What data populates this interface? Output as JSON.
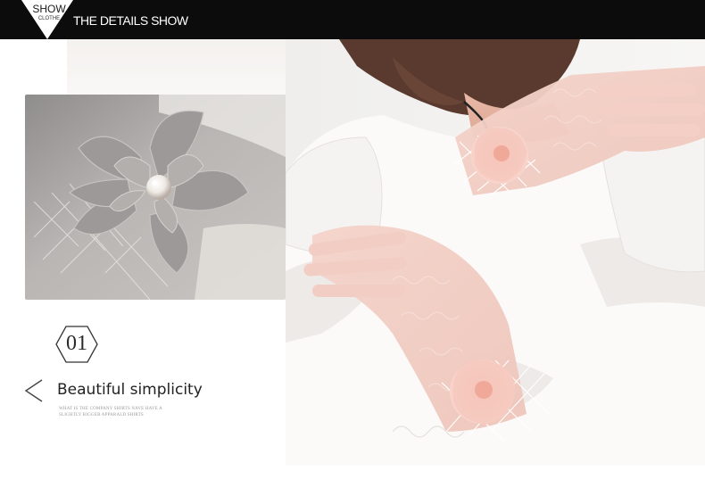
{
  "header": {
    "badge_top": "SHOW",
    "badge_bottom": "CLOTHE",
    "title": "THE DETAILS SHOW"
  },
  "feature": {
    "number": "01",
    "headline": "Beautiful simplicity",
    "caption_line_1": "WHAT IS THE COMPANY SHIRTS NAVE HAVE A",
    "caption_line_2": "SLIGHTLY BIGGER APPARALD SHIRTS"
  },
  "colors": {
    "header_bg": "#0c0c0c",
    "glove_pink": "#f2cfc6",
    "flower_pink": "#f5c2b8",
    "detail_grey": "#a9a6a5"
  },
  "icons": {
    "badge": "inverted-triangle-icon",
    "number_frame": "hexagon-icon",
    "nav": "chevron-left-icon"
  }
}
